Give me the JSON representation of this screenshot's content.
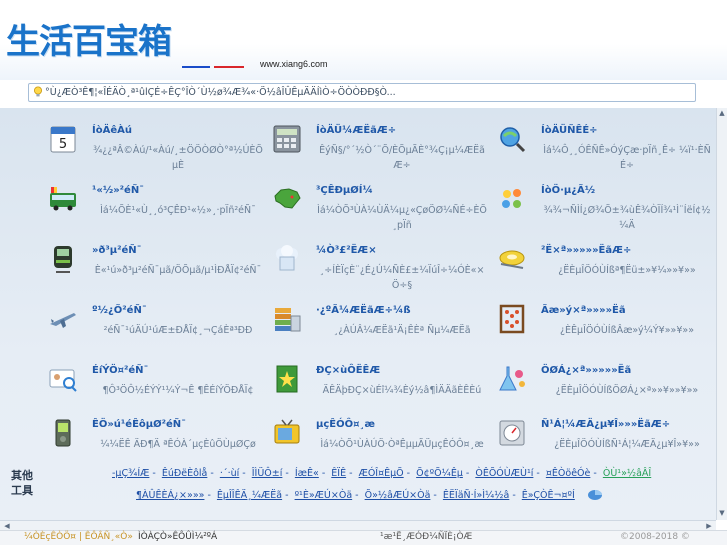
{
  "header": {
    "logo_text": "生活百宝箱",
    "site_url": "www.xiang6.com"
  },
  "search": {
    "text": "°Ù¿ÆÒ³Ê¶¦«ÎÉÄÒ¸ª¹ûlÇÉ÷ÊÇ°ÎÒ´Ù½ø¾Æ¾«·Ö½âÎÛÊµÄÄÍìÒ÷ÖÒÒÐÐ§Ò..."
  },
  "tiles": [
    {
      "title": "ÍòÄêÀú",
      "desc": "¾¿¿ªÂ©Àú/¹«Àú/¸±ÖÖÒØÒ°ª½ÚÈÕµÈ",
      "icon": "calendar-icon"
    },
    {
      "title": "ÍòÄÜ¼ÆËãÆ÷",
      "desc": "ÊýÑ§/°´½Ò´¨Õ/ÈÕµÃÈ°¾Ç¡µ¼ÆËãÆ÷",
      "icon": "calculator-icon"
    },
    {
      "title": "ÍòÄÜÑÊÉ÷",
      "desc": "Ìá¼Ô¸¸ÓÊÑÊ»ÓýÇæ·pÏñ¸Ê÷ ¼ï¹·ÈÑÉ÷",
      "icon": "search-globe-icon"
    },
    {
      "title": "¹«½»²éÑ¯",
      "desc": "Ìá¼ÕÈ¹«Ù¸¸ó³ÇÊÐ¹«½»¸·pÏñ²éÑ¯",
      "icon": "bus-icon"
    },
    {
      "title": "³ÇÊÐµØÍ¼",
      "desc": "Ìá¼ÒÕ³ÙÀ¼ÙÄ¼µ¿«ÇøÖØ¼ÑÉ÷ÈÕ¸pÏñ",
      "icon": "china-map-icon"
    },
    {
      "title": "ÍòÖ·µ¿Ã½",
      "desc": "¾¾¬ÑÌÍ¿Ø¾Õ±¾ùÊ¾ÒÏÍ¾¹Ì¨ÍëÍ¢½¼Ä",
      "icon": "map-pin-icon"
    },
    {
      "title": "»ð³µ²éÑ¯",
      "desc": "È«¹ú»ð³µ²éÑ¯µã/ÖÕµã/µ¹ÌÐÅÏ¢²éÑ¯",
      "icon": "train-icon"
    },
    {
      "title": "¼Ò³£²ËÆ×",
      "desc": "¸÷ÍÈÏçÈ¨¿É¿Ú¼ÑÈ£±¼ÏúÎ÷¼ÓÈ«×Ö÷§",
      "icon": "chef-hat-icon"
    },
    {
      "title": "²Ë×ª»»»»»ËãÆ÷",
      "desc": "¿ËÈµÎÖÓÙÍßª¶Ëü±»¥¼»»¥»»",
      "icon": "tape-measure-icon"
    },
    {
      "title": "º½¿Õ²éÑ¯",
      "desc": "²éÑ¯¹úÄÚ¹úÆ±ÐÅÏ¢¸¬ÇáÈª³ÐÐ",
      "icon": "airplane-icon"
    },
    {
      "title": "·¿ºÃ¼ÆËãÆ÷¼ß",
      "desc": "¸¿ÀÚÂ¼ÆËã¹Ä¡ÊÈª Ñµ¼ÆËã",
      "icon": "money-stack-icon"
    },
    {
      "title": "Ãæ»ý×ª»»»»Ëã",
      "desc": "¿ÈÊµÎÖÓÙÍßÂæ»ý¼Ý¥»»¥»»",
      "icon": "abacus-icon"
    },
    {
      "title": "ÉíÝÖ¤²éÑ¯",
      "desc": "¶Ô³ÖÔ½ÉÝÝ¹¼Ý¬Ê ¶ÊÉíÝÖÐÅÏ¢",
      "icon": "id-card-icon"
    },
    {
      "title": "ÐÇ×ùÔËÊÆ",
      "desc": "ÄÊÄþÐÇ×ùÉî¼¾Èý½â¶ÌÄÄãÈÊÈú",
      "icon": "star-book-icon"
    },
    {
      "title": "ÖØÁ¿×ª»»»»»Ëã",
      "desc": "¿ËÈµÎÖÓÙÍßÖØÁ¿×ª»»¥»»¥»»",
      "icon": "chemistry-icon"
    },
    {
      "title": "ÊÖ»ú¹éÊôµØ²éÑ¯",
      "desc": "¼¼ËÊ ÄÐ¶Ä ªÊÓÀ´µçÈûÖÙµØÇø",
      "icon": "mobile-phone-icon"
    },
    {
      "title": "µçÊÓÔ¤¸æ",
      "desc": "Ìá¼ÒÕ¹ÙÀÚÖ·ÒªÊµµÃÜµçÊÓÔ¤¸æ",
      "icon": "tv-icon"
    },
    {
      "title": "Ñ¹Á¦¼ÆÄ¿µ¥Î»»»ËãÆ÷",
      "desc": "¿ËÈµÎÖÓÙÍßÑ¹Á¦¼ÆÄ¿µ¥Î»¥»»",
      "icon": "pressure-gauge-icon"
    }
  ],
  "other_tools": {
    "label_line1": "其他",
    "label_line2": "工具",
    "row1": [
      "-µÇ¾ÍÆ",
      "ÊúÐëÈôlå",
      "·´·ùí",
      "ÎÌÜÔ±í",
      "ÍæÊ«",
      "ÊÏÊ",
      "ÆÓÎ¤ÊµÕ",
      "Õ¢ºÕ¼Êµ",
      "ÒÊÕÓÙÆÙ¹í",
      "¤ÊÒöêÓè",
      "ÒÙ¹»½âÂÎ"
    ],
    "row2": [
      "¶ÀÛÊÈÁ¿×»»»",
      "ÊµÎÎÊÄ¸¼ÆËã",
      "º¹È»ÆÚ×Òä",
      "Õ»½âÆÚ×Òä",
      "ÊËÏäÑ·Í»Ì¼½â",
      "Ê»ÇÒÊ¬¤ºÍ"
    ]
  },
  "footer": {
    "left": "¼ÒÈçÊÒÖ¤ | ÊÔÂÑ¸«Ò»",
    "middle": "ÌÒÀÇÒ»ÊÔÛÌ¼²ºÁ",
    "right": "¹æ¹Ë¸ÆÓÐ¼ÑÏÈ¡ÒÆ",
    "copyright": "©2008-2018 ©"
  }
}
